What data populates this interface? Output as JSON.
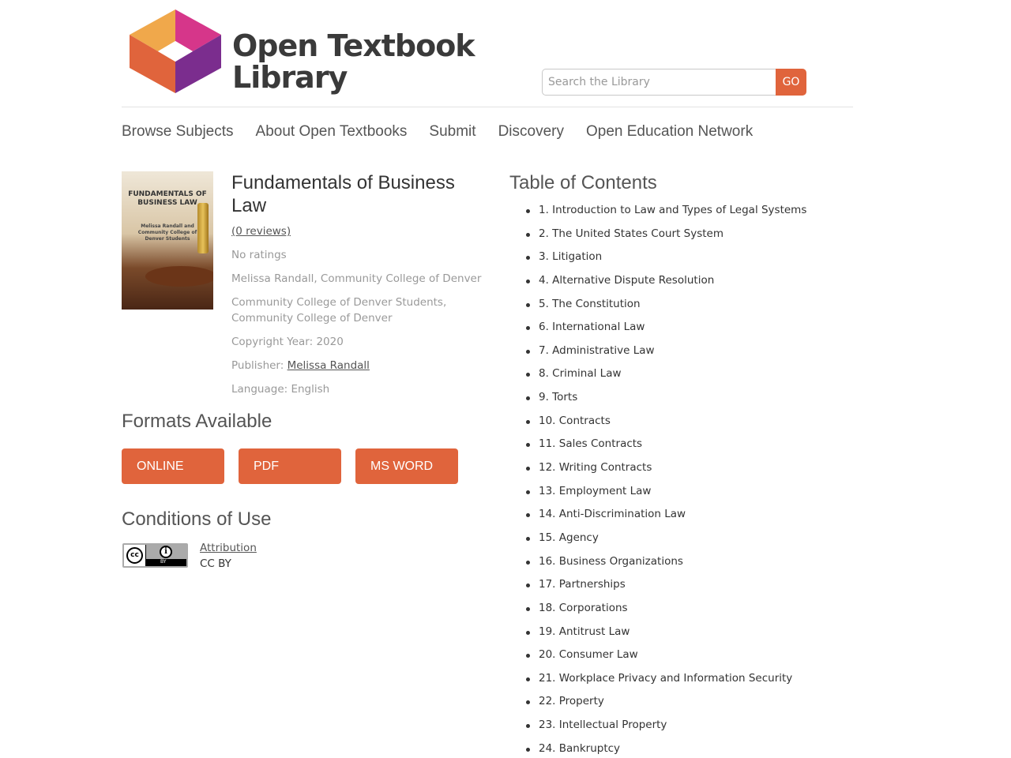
{
  "header": {
    "logo_line1": "Open Textbook",
    "logo_line2": "Library",
    "search_placeholder": "Search the Library",
    "search_button": "GO",
    "colors": {
      "accent": "#e0643c",
      "logo_orange": "#f0a84b",
      "logo_pink": "#d6368a",
      "logo_purple": "#7b2d8e",
      "logo_red": "#e0643c"
    }
  },
  "nav": [
    "Browse Subjects",
    "About Open Textbooks",
    "Submit",
    "Discovery",
    "Open Education Network"
  ],
  "book": {
    "cover_title": "FUNDAMENTALS OF BUSINESS LAW",
    "cover_authors": "Melissa Randall and Community College of Denver Students",
    "title": "Fundamentals of Business Law",
    "reviews_link": "(0 reviews)",
    "ratings": "No ratings",
    "author": "Melissa Randall, Community College of Denver",
    "contributors": "Community College of Denver Students, Community College of Denver",
    "copyright": "Copyright Year: 2020",
    "publisher_label": "Publisher:",
    "publisher": "Melissa Randall",
    "language": "Language: English"
  },
  "formats": {
    "heading": "Formats Available",
    "buttons": [
      "ONLINE",
      "PDF",
      "MS WORD"
    ]
  },
  "conditions": {
    "heading": "Conditions of Use",
    "badge_cc": "cc",
    "badge_by": "BY",
    "license_link": "Attribution",
    "license_code": "CC BY"
  },
  "toc": {
    "heading": "Table of Contents",
    "items": [
      "1. Introduction to Law and Types of Legal Systems",
      "2. The United States Court System",
      "3. Litigation",
      "4. Alternative Dispute Resolution",
      "5. The Constitution",
      "6. International Law",
      "7. Administrative Law",
      "8. Criminal Law",
      "9. Torts",
      "10. Contracts",
      "11. Sales Contracts",
      "12. Writing Contracts",
      "13. Employment Law",
      "14. Anti-Discrimination Law",
      "15. Agency",
      "16. Business Organizations",
      "17. Partnerships",
      "18. Corporations",
      "19. Antitrust Law",
      "20. Consumer Law",
      "21. Workplace Privacy and Information Security",
      "22. Property",
      "23. Intellectual Property",
      "24. Bankruptcy"
    ]
  }
}
